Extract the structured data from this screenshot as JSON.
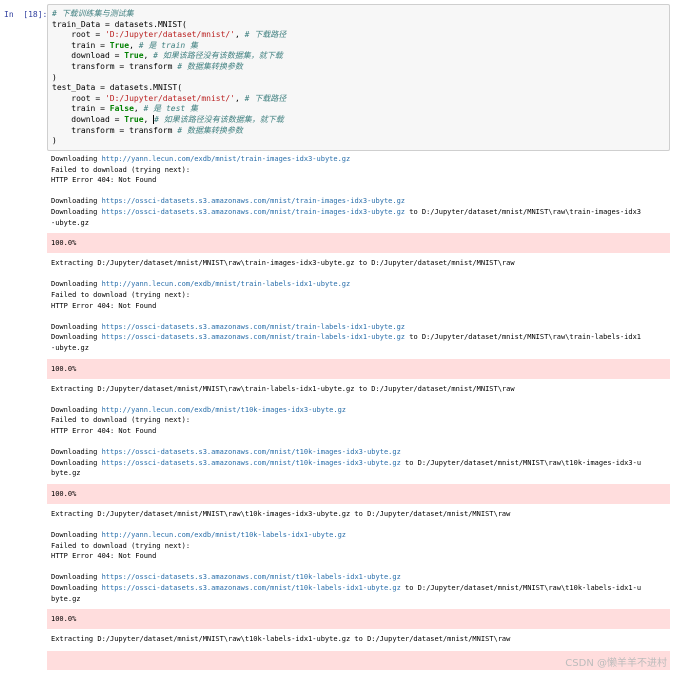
{
  "cell": {
    "prompt": "In  [18]:",
    "code": {
      "comment_top": "# 下载训练集与测试集",
      "train_head": "train_Data = datasets.MNIST(",
      "test_head": "test_Data = datasets.MNIST(",
      "root_kw": "root = ",
      "root_val": "'D:/Jupyter/dataset/mnist/'",
      "root_comment": "# 下载路径",
      "train_kw": "train = ",
      "train_true": "True",
      "train_false": "False",
      "train_comment_train": "# 是 train 集",
      "train_comment_test": "# 是 test 集",
      "download_kw": "download = ",
      "download_val": "True",
      "download_comment": "# 如果该路径没有该数据集，就下载",
      "transform_kw": "transform = transform ",
      "transform_comment": "# 数据集转换参数",
      "close": ")"
    }
  },
  "output": {
    "sections": [
      {
        "download_http": "Downloading ",
        "http_url": "http://yann.lecun.com/exdb/mnist/train-images-idx3-ubyte.gz",
        "failed": "Failed to download (trying next):",
        "error": "HTTP Error 404: Not Found",
        "https_url": "https://ossci-datasets.s3.amazonaws.com/mnist/train-images-idx3-ubyte.gz",
        "dl_to_prefix": "Downloading ",
        "dl_to_suffix": " to D:/Jupyter/dataset/mnist/MNIST\\raw\\train-images-idx3",
        "dl_to_wrap": "-ubyte.gz",
        "progress": "100.0%",
        "extract": "Extracting D:/Jupyter/dataset/mnist/MNIST\\raw\\train-images-idx3-ubyte.gz to D:/Jupyter/dataset/mnist/MNIST\\raw"
      },
      {
        "download_http": "Downloading ",
        "http_url": "http://yann.lecun.com/exdb/mnist/train-labels-idx1-ubyte.gz",
        "failed": "Failed to download (trying next):",
        "error": "HTTP Error 404: Not Found",
        "https_url": "https://ossci-datasets.s3.amazonaws.com/mnist/train-labels-idx1-ubyte.gz",
        "dl_to_prefix": "Downloading ",
        "dl_to_suffix": " to D:/Jupyter/dataset/mnist/MNIST\\raw\\train-labels-idx1",
        "dl_to_wrap": "-ubyte.gz",
        "progress": "100.0%",
        "extract": "Extracting D:/Jupyter/dataset/mnist/MNIST\\raw\\train-labels-idx1-ubyte.gz to D:/Jupyter/dataset/mnist/MNIST\\raw"
      },
      {
        "download_http": "Downloading ",
        "http_url": "http://yann.lecun.com/exdb/mnist/t10k-images-idx3-ubyte.gz",
        "failed": "Failed to download (trying next):",
        "error": "HTTP Error 404: Not Found",
        "https_url": "https://ossci-datasets.s3.amazonaws.com/mnist/t10k-images-idx3-ubyte.gz",
        "dl_to_prefix": "Downloading ",
        "dl_to_suffix": " to D:/Jupyter/dataset/mnist/MNIST\\raw\\t10k-images-idx3-u",
        "dl_to_wrap": "byte.gz",
        "progress": "100.0%",
        "extract": "Extracting D:/Jupyter/dataset/mnist/MNIST\\raw\\t10k-images-idx3-ubyte.gz to D:/Jupyter/dataset/mnist/MNIST\\raw"
      },
      {
        "download_http": "Downloading ",
        "http_url": "http://yann.lecun.com/exdb/mnist/t10k-labels-idx1-ubyte.gz",
        "failed": "Failed to download (trying next):",
        "error": "HTTP Error 404: Not Found",
        "https_url": "https://ossci-datasets.s3.amazonaws.com/mnist/t10k-labels-idx1-ubyte.gz",
        "dl_to_prefix": "Downloading ",
        "dl_to_suffix": " to D:/Jupyter/dataset/mnist/MNIST\\raw\\t10k-labels-idx1-u",
        "dl_to_wrap": "byte.gz",
        "progress": "100.0%",
        "extract": "Extracting D:/Jupyter/dataset/mnist/MNIST\\raw\\t10k-labels-idx1-ubyte.gz to D:/Jupyter/dataset/mnist/MNIST\\raw"
      }
    ]
  },
  "watermark": "CSDN @懒羊羊不进村",
  "colors": {
    "stderr_bg": "#ffdddd",
    "link": "#296eaa",
    "prompt": "#303f9f"
  }
}
